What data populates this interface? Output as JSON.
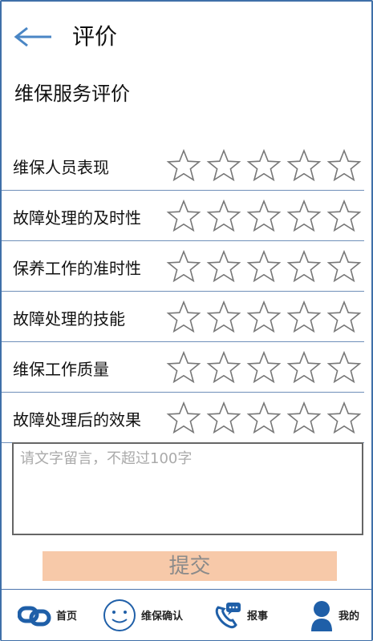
{
  "header": {
    "title": "评价",
    "back_icon": "back-arrow-icon"
  },
  "section_title": "维保服务评价",
  "ratings": [
    {
      "label": "维保人员表现",
      "stars": 0,
      "max": 5
    },
    {
      "label": "故障处理的及时性",
      "stars": 0,
      "max": 5
    },
    {
      "label": "保养工作的准时性",
      "stars": 0,
      "max": 5
    },
    {
      "label": "故障处理的技能",
      "stars": 0,
      "max": 5
    },
    {
      "label": "维保工作质量",
      "stars": 0,
      "max": 5
    },
    {
      "label": "故障处理后的效果",
      "stars": 0,
      "max": 5
    }
  ],
  "comment": {
    "placeholder": "请文字留言，不超过100字",
    "value": ""
  },
  "submit_label": "提交",
  "tabs": [
    {
      "label": "首页",
      "icon": "home-link-icon"
    },
    {
      "label": "维保确认",
      "icon": "smiley-icon"
    },
    {
      "label": "报事",
      "icon": "phone-message-icon"
    },
    {
      "label": "我的",
      "icon": "user-icon"
    }
  ],
  "colors": {
    "accent": "#3f6fa8",
    "submit_bg": "#f7c9a9",
    "star_stroke": "#777777",
    "icon_blue": "#1f5fa8"
  }
}
